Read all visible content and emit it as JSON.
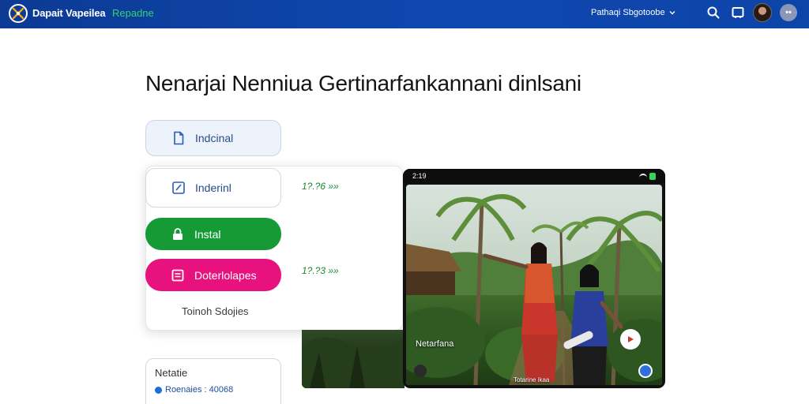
{
  "header": {
    "brand": "Dapait Vapeilea",
    "brand_tag": "Repadne",
    "user_name": "Pathaqi Sbgotoobe",
    "icons": [
      "logo-icon",
      "search-icon",
      "screen-icon",
      "avatar",
      "more-icon"
    ],
    "more_label": "••"
  },
  "page": {
    "title": "Nenarjai Nenniua Gertinarfankannani dinlsani"
  },
  "options": {
    "installed_label": "Indcinal",
    "installed2_label": "Inderinl",
    "install_label": "Instal",
    "pink_label": "Doterlolapes",
    "touch_label": "Toinoh Sdojies"
  },
  "prices": {
    "first": "1?.?6 »»",
    "second": "1?.?3 »»"
  },
  "notes": {
    "title": "Netatie",
    "meta": "Roenaies : 40068"
  },
  "preview": {
    "time": "2:19",
    "scene_label": "Netarfana",
    "scene_caption": "Totarine ikaa"
  },
  "colors": {
    "header_bg": "#0f48b0",
    "brand_tag": "#2fd46c",
    "install_green": "#169a35",
    "pink": "#e8127e",
    "price_green": "#168a30",
    "link_blue": "#1c4ea3"
  }
}
